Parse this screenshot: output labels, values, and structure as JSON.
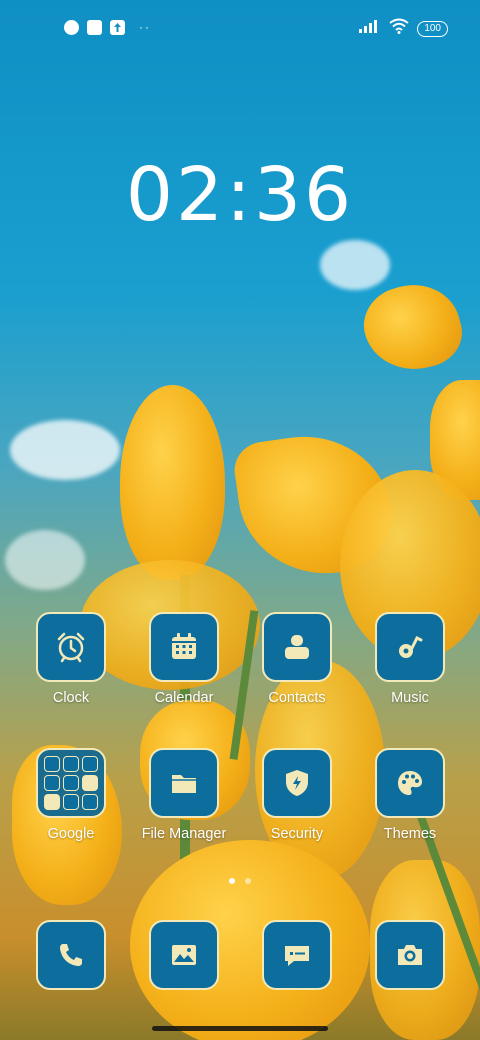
{
  "status_bar": {
    "left_icons": [
      "notification-icon",
      "square-icon",
      "upload-icon"
    ],
    "more": "··",
    "battery": "100"
  },
  "lockscreen": {
    "time": "02:36"
  },
  "apps_row1": [
    {
      "label": "Clock",
      "icon": "alarm-clock-icon"
    },
    {
      "label": "Calendar",
      "icon": "calendar-icon"
    },
    {
      "label": "Contacts",
      "icon": "contacts-icon"
    },
    {
      "label": "Music",
      "icon": "music-note-icon"
    }
  ],
  "apps_row2": [
    {
      "label": "Google",
      "icon": "folder-icon"
    },
    {
      "label": "File Manager",
      "icon": "folder-icon"
    },
    {
      "label": "Security",
      "icon": "shield-bolt-icon"
    },
    {
      "label": "Themes",
      "icon": "palette-icon"
    }
  ],
  "dock": [
    {
      "icon": "phone-icon"
    },
    {
      "icon": "gallery-icon"
    },
    {
      "icon": "messages-icon"
    },
    {
      "icon": "camera-icon"
    }
  ],
  "pages": {
    "count": 2,
    "active": 1
  },
  "colors": {
    "icon_bg": "#0d6e9e",
    "icon_border": "#f3e9b8",
    "glyph": "#f3e9b8"
  }
}
